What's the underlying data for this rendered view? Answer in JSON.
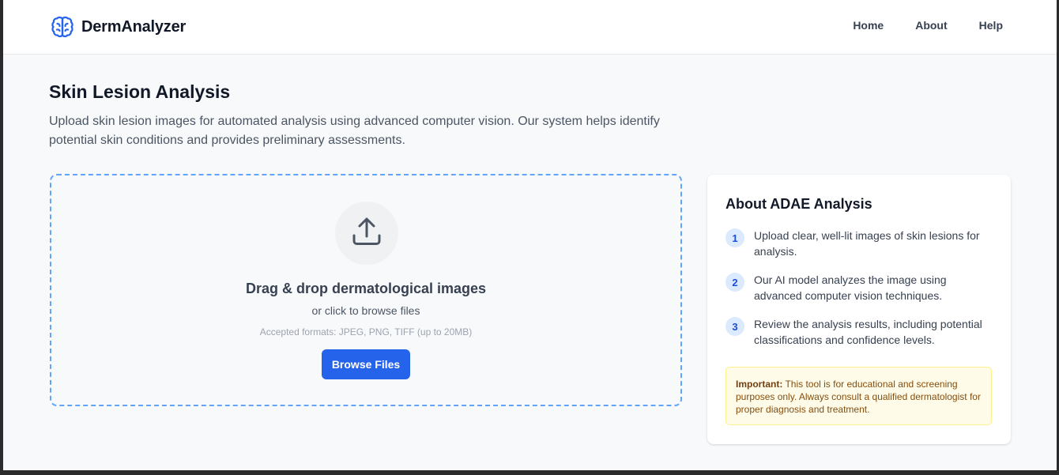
{
  "header": {
    "brand": "DermAnalyzer",
    "nav": [
      "Home",
      "About",
      "Help"
    ]
  },
  "intro": {
    "title": "Skin Lesion Analysis",
    "description": "Upload skin lesion images for automated analysis using advanced computer vision. Our system helps identify potential skin conditions and provides preliminary assessments."
  },
  "dropzone": {
    "title": "Drag & drop dermatological images",
    "subtitle": "or click to browse files",
    "formats": "Accepted formats: JPEG, PNG, TIFF (up to 20MB)",
    "button": "Browse Files"
  },
  "about": {
    "title": "About ADAE Analysis",
    "steps": [
      {
        "num": "1",
        "text": "Upload clear, well-lit images of skin lesions for analysis."
      },
      {
        "num": "2",
        "text": "Our AI model analyzes the image using advanced computer vision techniques."
      },
      {
        "num": "3",
        "text": "Review the analysis results, including potential classifications and confidence levels."
      }
    ],
    "notice_label": "Important:",
    "notice_text": "This tool is for educational and screening purposes only. Always consult a qualified dermatologist for proper diagnosis and treatment."
  },
  "colors": {
    "accent": "#2563eb",
    "dropzone_border": "#60a5fa",
    "notice_bg": "#fefce8"
  },
  "icons": {
    "brand": "brain-icon",
    "upload": "upload-icon"
  }
}
